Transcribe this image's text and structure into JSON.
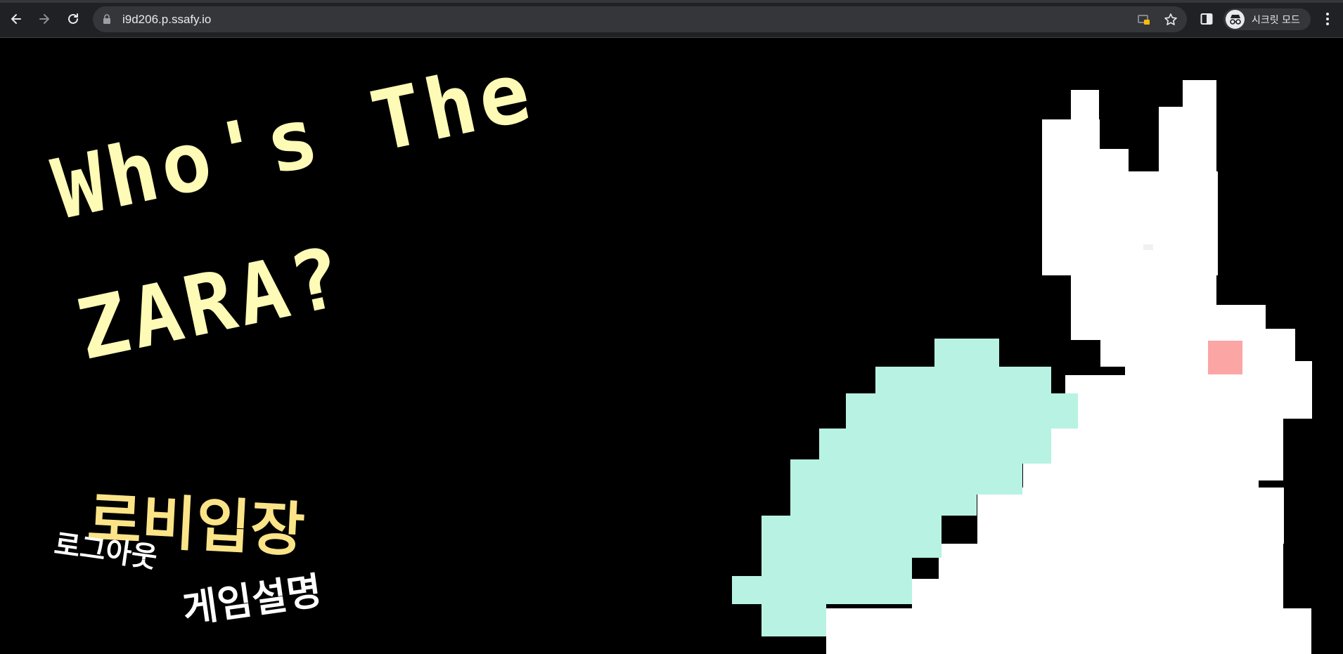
{
  "browser": {
    "url": "i9d206.p.ssafy.io",
    "profile_label": "시크릿 모드",
    "icons": {
      "back": "arrow-left-icon",
      "forward": "arrow-right-icon",
      "reload": "reload-icon",
      "lock": "lock-icon",
      "extension": "extension-icon",
      "bookmark": "star-icon",
      "side_panel": "side-panel-icon",
      "incognito": "incognito-icon",
      "menu": "kebab-menu-icon"
    }
  },
  "page": {
    "title_line1": "Who's The",
    "title_line2": "ZARA?",
    "menu": {
      "lobby": "로비입장",
      "logout": "로그아웃",
      "how_to_play": "게임설명"
    }
  },
  "colors": {
    "background": "#000000",
    "title": "#fdfbb6",
    "lobby": "#fbe487",
    "menu_white": "#ffffff",
    "rabbit_body": "#ffffff",
    "rabbit_carrot_leaf": "#b8f2e2",
    "rabbit_blush": "#fca5a5"
  }
}
